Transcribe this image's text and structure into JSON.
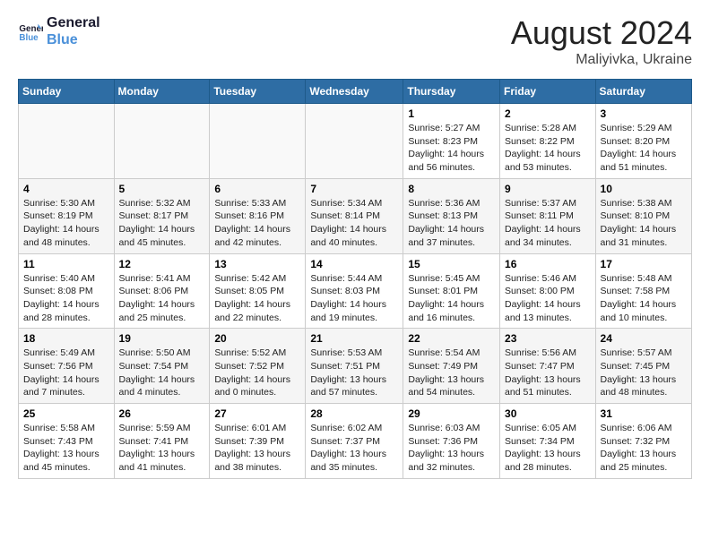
{
  "header": {
    "logo_line1": "General",
    "logo_line2": "Blue",
    "title": "August 2024",
    "subtitle": "Maliyivka, Ukraine"
  },
  "weekdays": [
    "Sunday",
    "Monday",
    "Tuesday",
    "Wednesday",
    "Thursday",
    "Friday",
    "Saturday"
  ],
  "weeks": [
    [
      {
        "day": "",
        "info": ""
      },
      {
        "day": "",
        "info": ""
      },
      {
        "day": "",
        "info": ""
      },
      {
        "day": "",
        "info": ""
      },
      {
        "day": "1",
        "info": "Sunrise: 5:27 AM\nSunset: 8:23 PM\nDaylight: 14 hours\nand 56 minutes."
      },
      {
        "day": "2",
        "info": "Sunrise: 5:28 AM\nSunset: 8:22 PM\nDaylight: 14 hours\nand 53 minutes."
      },
      {
        "day": "3",
        "info": "Sunrise: 5:29 AM\nSunset: 8:20 PM\nDaylight: 14 hours\nand 51 minutes."
      }
    ],
    [
      {
        "day": "4",
        "info": "Sunrise: 5:30 AM\nSunset: 8:19 PM\nDaylight: 14 hours\nand 48 minutes."
      },
      {
        "day": "5",
        "info": "Sunrise: 5:32 AM\nSunset: 8:17 PM\nDaylight: 14 hours\nand 45 minutes."
      },
      {
        "day": "6",
        "info": "Sunrise: 5:33 AM\nSunset: 8:16 PM\nDaylight: 14 hours\nand 42 minutes."
      },
      {
        "day": "7",
        "info": "Sunrise: 5:34 AM\nSunset: 8:14 PM\nDaylight: 14 hours\nand 40 minutes."
      },
      {
        "day": "8",
        "info": "Sunrise: 5:36 AM\nSunset: 8:13 PM\nDaylight: 14 hours\nand 37 minutes."
      },
      {
        "day": "9",
        "info": "Sunrise: 5:37 AM\nSunset: 8:11 PM\nDaylight: 14 hours\nand 34 minutes."
      },
      {
        "day": "10",
        "info": "Sunrise: 5:38 AM\nSunset: 8:10 PM\nDaylight: 14 hours\nand 31 minutes."
      }
    ],
    [
      {
        "day": "11",
        "info": "Sunrise: 5:40 AM\nSunset: 8:08 PM\nDaylight: 14 hours\nand 28 minutes."
      },
      {
        "day": "12",
        "info": "Sunrise: 5:41 AM\nSunset: 8:06 PM\nDaylight: 14 hours\nand 25 minutes."
      },
      {
        "day": "13",
        "info": "Sunrise: 5:42 AM\nSunset: 8:05 PM\nDaylight: 14 hours\nand 22 minutes."
      },
      {
        "day": "14",
        "info": "Sunrise: 5:44 AM\nSunset: 8:03 PM\nDaylight: 14 hours\nand 19 minutes."
      },
      {
        "day": "15",
        "info": "Sunrise: 5:45 AM\nSunset: 8:01 PM\nDaylight: 14 hours\nand 16 minutes."
      },
      {
        "day": "16",
        "info": "Sunrise: 5:46 AM\nSunset: 8:00 PM\nDaylight: 14 hours\nand 13 minutes."
      },
      {
        "day": "17",
        "info": "Sunrise: 5:48 AM\nSunset: 7:58 PM\nDaylight: 14 hours\nand 10 minutes."
      }
    ],
    [
      {
        "day": "18",
        "info": "Sunrise: 5:49 AM\nSunset: 7:56 PM\nDaylight: 14 hours\nand 7 minutes."
      },
      {
        "day": "19",
        "info": "Sunrise: 5:50 AM\nSunset: 7:54 PM\nDaylight: 14 hours\nand 4 minutes."
      },
      {
        "day": "20",
        "info": "Sunrise: 5:52 AM\nSunset: 7:52 PM\nDaylight: 14 hours\nand 0 minutes."
      },
      {
        "day": "21",
        "info": "Sunrise: 5:53 AM\nSunset: 7:51 PM\nDaylight: 13 hours\nand 57 minutes."
      },
      {
        "day": "22",
        "info": "Sunrise: 5:54 AM\nSunset: 7:49 PM\nDaylight: 13 hours\nand 54 minutes."
      },
      {
        "day": "23",
        "info": "Sunrise: 5:56 AM\nSunset: 7:47 PM\nDaylight: 13 hours\nand 51 minutes."
      },
      {
        "day": "24",
        "info": "Sunrise: 5:57 AM\nSunset: 7:45 PM\nDaylight: 13 hours\nand 48 minutes."
      }
    ],
    [
      {
        "day": "25",
        "info": "Sunrise: 5:58 AM\nSunset: 7:43 PM\nDaylight: 13 hours\nand 45 minutes."
      },
      {
        "day": "26",
        "info": "Sunrise: 5:59 AM\nSunset: 7:41 PM\nDaylight: 13 hours\nand 41 minutes."
      },
      {
        "day": "27",
        "info": "Sunrise: 6:01 AM\nSunset: 7:39 PM\nDaylight: 13 hours\nand 38 minutes."
      },
      {
        "day": "28",
        "info": "Sunrise: 6:02 AM\nSunset: 7:37 PM\nDaylight: 13 hours\nand 35 minutes."
      },
      {
        "day": "29",
        "info": "Sunrise: 6:03 AM\nSunset: 7:36 PM\nDaylight: 13 hours\nand 32 minutes."
      },
      {
        "day": "30",
        "info": "Sunrise: 6:05 AM\nSunset: 7:34 PM\nDaylight: 13 hours\nand 28 minutes."
      },
      {
        "day": "31",
        "info": "Sunrise: 6:06 AM\nSunset: 7:32 PM\nDaylight: 13 hours\nand 25 minutes."
      }
    ]
  ]
}
